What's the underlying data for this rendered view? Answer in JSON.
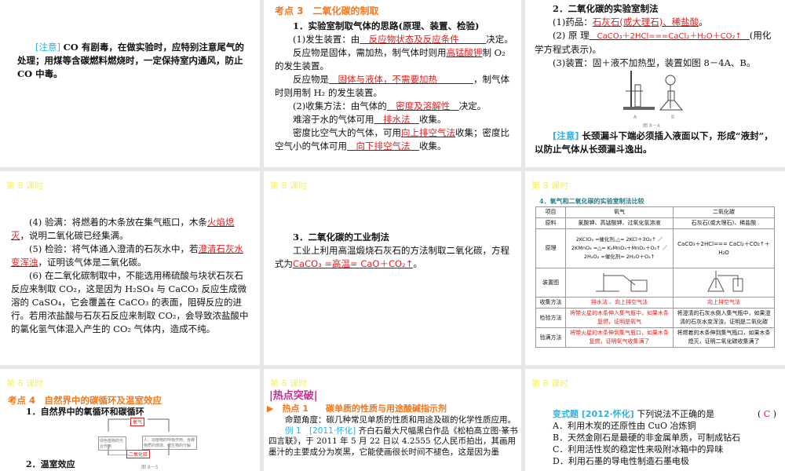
{
  "lesson_label": "第 8 课时",
  "slide1": {
    "note_label": "[注意]",
    "text": "CO 有剧毒，在做实验时，应特别注意尾气的处理；用煤等含碳燃料燃烧时，一定保持室内通风，防止 CO 中毒。"
  },
  "slide2": {
    "heading": "考点 3　二氧化碳的制取",
    "l1": "1．实验室制取气体的思路(原理、装置、检验)",
    "l2a": "(1)发生装置：由",
    "l2ans": "　反应物状态及反应条件　　　",
    "l2b": "决定。",
    "l3a": "反应物是固体，需加热，制气体时则用",
    "l3ans": "高锰酸钾",
    "l3b": "制 O₂ 的发生装置。",
    "l4a": "反应物是",
    "l4ans": "　固体与液体，不需要加热　　　　",
    "l4b": "，制气体时则用制 H₂ 的发生装置。",
    "l5a": "(2)收集方法：由气体的",
    "l5ans": "　密度及溶解性　",
    "l5b": "决定。",
    "l6a": "难溶于水的气体可用",
    "l6ans": "　排水法　",
    "l6b": "收集。",
    "l7a": "密度比空气大的气体，可用",
    "l7ans": "向上排空气法",
    "l7b": "收集；密度比空气小的气体可用",
    "l7ans2": "　向下排空气法　",
    "l7c": "收集。"
  },
  "slide3": {
    "l1": "2．二氧化碳的实验室制法",
    "l2a": "(1)药品：",
    "l2ans": "石灰石(或大理石)、稀盐酸",
    "l2b": "。",
    "l3a": "(2) 原 理",
    "l3ans": "　CaCO₃＋2HCl===CaCl₂＋H₂O＋CO₂↑　",
    "l3b": "(用化学方程式表示)。",
    "l4": "(3)装置：固＋液不加热型，装置如图 8－4A、B。",
    "fig_a": "A",
    "fig_b": "B",
    "fig_caption": "图 8－4",
    "note_label": "[注意]",
    "note": "长颈漏斗下端必须插入液面以下，形成“液封”，以防止气体从长颈漏斗逸出。"
  },
  "slide4": {
    "l1a": "(4) 验满：将燃着的木条放在集气瓶口，木条",
    "l1ans": "火焰熄灭",
    "l1b": "，说明二氧化碳已经集满。",
    "l2a": "(5) 检验：将气体通入澄清的石灰水中，若",
    "l2ans": "澄清石灰水变浑浊",
    "l2b": "，证明该气体是二氧化碳。",
    "l3": "(6) 在二氧化碳制取中，不能选用稀硫酸与块状石灰石反应来制取 CO₂，这是因为 H₂SO₄ 与 CaCO₃ 反应生成微溶的 CaSO₄，它会覆盖在 CaCO₃ 的表面，阻碍反应的进行。若用浓盐酸与石灰石反应来制取 CO₂，会导致浓盐酸中的氯化氢气体混入产生的 CO₂ 气体内，造成不纯。"
  },
  "slide5": {
    "l1": "3．二氧化碳的工业制法",
    "l2": "工业上利用高温煅烧石灰石的方法制取二氧化碳，方程式为",
    "ans": "CaCO₃ =高温= CaO＋CO₂↑",
    "end": "。"
  },
  "slide6": {
    "title": "4．氧气和二氧化碳的实验室制法比较",
    "headers": [
      "项目",
      "氧气",
      "二氧化碳"
    ],
    "rows": [
      {
        "label": "原料",
        "o2": "氯酸钾、高锰酸钾、过氧化氢溶液",
        "co2": "石灰石(或大理石)、稀盐酸"
      },
      {
        "label": "原理",
        "o2": "2KClO₃ =催化剂,△= 2KCl＋3O₂↑ ／ 2KMnO₄ =△= K₂MnO₄＋MnO₂＋O₂↑ ／ 2H₂O₂ =催化剂= 2H₂O＋O₂↑",
        "co2": "CaCO₃＋2HCl=== CaCl₂＋CO₂↑＋H₂O"
      },
      {
        "label": "装置图",
        "o2": "",
        "co2": ""
      },
      {
        "label": "收集方法",
        "o2": "排水法 、向上排空气法",
        "co2": "向上排空气法"
      },
      {
        "label": "检验方法",
        "o2": "将带火星的木条伸入集气瓶中，如果木条复燃，证明是氧气",
        "co2": "将澄清的石灰水倒入集气瓶中，如果澄清的石灰水变浑浊，证明是二氧化碳"
      },
      {
        "label": "验满方法",
        "o2": "将带火星的木条伸到集气瓶口，如果木条复燃，证明氧气收集满了",
        "co2": "将燃着的木条伸到集气瓶口，如果木条熄灭，证明二氧化碳收集满了"
      }
    ]
  },
  "slide7": {
    "heading": "考点 4　自然界中的碳循环及温室效应",
    "l1": "1．自然界中的氧循环和碳循环",
    "node_o2": "氧气",
    "node_co2": "二氧化碳",
    "node_left": "绿色植物的光合作用",
    "node_right": "人、动植物的呼吸作用、含碳物质的燃烧、微生物的分解",
    "fig_caption": "图 8－5",
    "l2": "2．温室效应"
  },
  "slide8": {
    "section": "|热点突破|",
    "hot": "热点 1　　碳单质的性质与用途酸碱指示剂",
    "angle": "命题角度：碳几种常见单质的性质和用途及碳的化学性质应用。",
    "ex_label": "例 1　[2011·怀化]",
    "ex": "齐白石最大尺幅黑白作品《松柏高立图·篆书四言联》，于 2011 年 5 月 22 日以 4.2555 亿人民币拍出，其画用墨汁的主要成分为炭黑，它能使画很长时间不褪色，这是因为墨"
  },
  "slide9": {
    "label": "变式题 [2012·怀化]",
    "q": "下列说法不正确的是",
    "answer": "C",
    "options": [
      "A．利用木炭的还原性由 CuO 冶炼铜",
      "B．天然金刚石是最硬的非金属单质，可制成钻石",
      "C．利用活性炭的稳定性来吸附冰箱中的异味",
      "D．利用石墨的导电性制造石墨电极"
    ]
  }
}
